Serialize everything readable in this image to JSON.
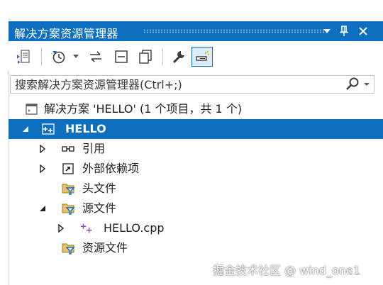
{
  "panel": {
    "title": "解决方案资源管理器",
    "title_buttons": [
      "dropdown-icon",
      "pin-icon",
      "close-icon"
    ],
    "accent_color": "#0e6fc0"
  },
  "toolbar": {
    "tools": [
      "switch-view-icon",
      "history-icon",
      "dropdown-icon",
      "sync-icon",
      "collapse-all-icon",
      "show-all-files-icon",
      "properties-wrench-icon",
      "preview-selected-icon"
    ],
    "active_tool": "preview-selected-icon"
  },
  "search": {
    "placeholder": "搜索解决方案资源管理器(Ctrl+;)"
  },
  "tree": {
    "solution": "解决方案 'HELLO' (1 个项目，共 1 个)",
    "project": "HELLO",
    "references": "引用",
    "external_deps": "外部依赖项",
    "header_files": "头文件",
    "source_files": "源文件",
    "cpp_file": "HELLO.cpp",
    "resource_files": "资源文件"
  },
  "watermark": "掘金技术社区 @ wind_one1"
}
